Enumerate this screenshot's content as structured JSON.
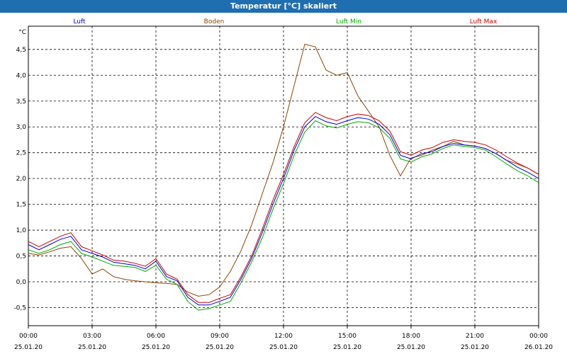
{
  "window": {
    "title": "Temperatur [°C] skaliert"
  },
  "chart_data": {
    "type": "line",
    "title": "Temperatur [°C] skaliert",
    "ylabel": "°C",
    "ylim": [
      -0.85,
      4.95
    ],
    "yticks": [
      -0.5,
      0.0,
      0.5,
      1.0,
      1.5,
      2.0,
      2.5,
      3.0,
      3.5,
      4.0,
      4.5
    ],
    "ytick_labels": [
      "-0,5",
      "0,0",
      "0,5",
      "1,0",
      "1,5",
      "2,0",
      "2,5",
      "3,0",
      "3,5",
      "4,0",
      "4,5"
    ],
    "xlim": [
      0,
      24
    ],
    "xticks": [
      0,
      3,
      6,
      9,
      12,
      15,
      18,
      21,
      24
    ],
    "xtick_labels": [
      {
        "time": "00:00",
        "date": "25.01.20"
      },
      {
        "time": "03:00",
        "date": "25.01.20"
      },
      {
        "time": "06:00",
        "date": "25.01.20"
      },
      {
        "time": "09:00",
        "date": "25.01.20"
      },
      {
        "time": "12:00",
        "date": "25.01.20"
      },
      {
        "time": "15:00",
        "date": "25.01.20"
      },
      {
        "time": "18:00",
        "date": "25.01.20"
      },
      {
        "time": "21:00",
        "date": "25.01.20"
      },
      {
        "time": "00:00",
        "date": "26.01.20"
      }
    ],
    "grid": true,
    "legend": "top",
    "x": [
      0,
      0.5,
      1,
      1.5,
      2,
      2.5,
      3,
      3.5,
      4,
      4.5,
      5,
      5.5,
      6,
      6.5,
      7,
      7.5,
      8,
      8.5,
      9,
      9.5,
      10,
      10.5,
      11,
      11.5,
      12,
      12.5,
      13,
      13.5,
      14,
      14.5,
      15,
      15.5,
      16,
      16.5,
      17,
      17.5,
      18,
      18.5,
      19,
      19.5,
      20,
      20.5,
      21,
      21.5,
      22,
      22.5,
      23,
      23.5,
      24
    ],
    "series": [
      {
        "name": "Luft",
        "color": "#0000cc",
        "values": [
          0.72,
          0.62,
          0.72,
          0.82,
          0.88,
          0.62,
          0.55,
          0.48,
          0.38,
          0.35,
          0.32,
          0.25,
          0.4,
          0.1,
          0.02,
          -0.3,
          -0.45,
          -0.45,
          -0.38,
          -0.3,
          0.05,
          0.45,
          0.95,
          1.5,
          2.0,
          2.55,
          3.0,
          3.2,
          3.1,
          3.05,
          3.12,
          3.18,
          3.15,
          3.05,
          2.85,
          2.45,
          2.38,
          2.48,
          2.52,
          2.62,
          2.68,
          2.65,
          2.63,
          2.58,
          2.48,
          2.35,
          2.22,
          2.12,
          2.0
        ]
      },
      {
        "name": "Boden",
        "color": "#8b4500",
        "values": [
          0.55,
          0.52,
          0.58,
          0.65,
          0.68,
          0.45,
          0.15,
          0.25,
          0.1,
          0.05,
          0.02,
          0.0,
          -0.02,
          -0.03,
          -0.05,
          -0.2,
          -0.28,
          -0.25,
          -0.1,
          0.2,
          0.6,
          1.1,
          1.7,
          2.3,
          3.0,
          3.8,
          4.6,
          4.55,
          4.1,
          4.0,
          4.05,
          3.6,
          3.3,
          3.0,
          2.45,
          2.05,
          2.4,
          2.45,
          2.55,
          2.62,
          2.72,
          2.65,
          2.63,
          2.58,
          2.48,
          2.35,
          2.28,
          2.2,
          2.08
        ]
      },
      {
        "name": "Luft Min",
        "color": "#00aa00",
        "values": [
          0.62,
          0.55,
          0.62,
          0.72,
          0.78,
          0.55,
          0.48,
          0.4,
          0.32,
          0.3,
          0.28,
          0.2,
          0.32,
          0.05,
          -0.05,
          -0.38,
          -0.55,
          -0.52,
          -0.45,
          -0.38,
          -0.02,
          0.38,
          0.85,
          1.4,
          1.9,
          2.45,
          2.9,
          3.12,
          3.02,
          2.98,
          3.05,
          3.1,
          3.08,
          2.98,
          2.78,
          2.38,
          2.32,
          2.42,
          2.48,
          2.58,
          2.65,
          2.62,
          2.6,
          2.55,
          2.42,
          2.28,
          2.15,
          2.05,
          1.92
        ]
      },
      {
        "name": "Luft Max",
        "color": "#cc0000",
        "values": [
          0.78,
          0.68,
          0.78,
          0.88,
          0.95,
          0.68,
          0.6,
          0.52,
          0.42,
          0.4,
          0.36,
          0.3,
          0.45,
          0.15,
          0.05,
          -0.25,
          -0.4,
          -0.4,
          -0.32,
          -0.25,
          0.1,
          0.5,
          1.02,
          1.58,
          2.08,
          2.62,
          3.08,
          3.28,
          3.18,
          3.12,
          3.2,
          3.25,
          3.22,
          3.12,
          2.92,
          2.52,
          2.45,
          2.55,
          2.6,
          2.7,
          2.75,
          2.72,
          2.7,
          2.65,
          2.55,
          2.42,
          2.3,
          2.2,
          2.08
        ]
      }
    ]
  }
}
